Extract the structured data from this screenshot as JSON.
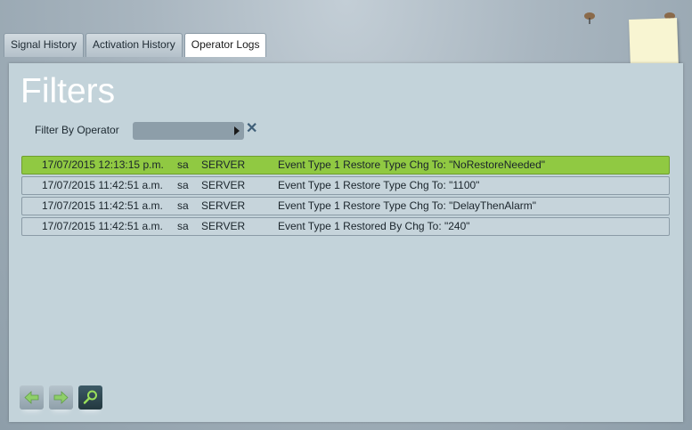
{
  "tabs": [
    {
      "label": "Signal History",
      "active": false
    },
    {
      "label": "Activation History",
      "active": false
    },
    {
      "label": "Operator Logs",
      "active": true
    }
  ],
  "panel": {
    "title": "Filters"
  },
  "filter": {
    "label": "Filter By Operator",
    "value": ""
  },
  "logs": [
    {
      "date": "17/07/2015 12:13:15 p.m.",
      "user": "sa",
      "source": "SERVER",
      "description": "Event Type 1 Restore Type Chg To: \"NoRestoreNeeded\"",
      "selected": true
    },
    {
      "date": "17/07/2015 11:42:51 a.m.",
      "user": "sa",
      "source": "SERVER",
      "description": "Event Type 1 Restore Type Chg To: \"1100\"",
      "selected": false
    },
    {
      "date": "17/07/2015 11:42:51 a.m.",
      "user": "sa",
      "source": "SERVER",
      "description": "Event Type 1 Restore Type Chg To: \"DelayThenAlarm\"",
      "selected": false
    },
    {
      "date": "17/07/2015 11:42:51 a.m.",
      "user": "sa",
      "source": "SERVER",
      "description": "Event Type 1 Restored By Chg To: \"240\"",
      "selected": false
    }
  ],
  "icons": {
    "prev": "arrow-left-icon",
    "next": "arrow-right-icon",
    "search": "magnifier-icon",
    "clear": "close-icon"
  },
  "colors": {
    "selected_row": "#90c942",
    "panel": "#c3d3da"
  }
}
